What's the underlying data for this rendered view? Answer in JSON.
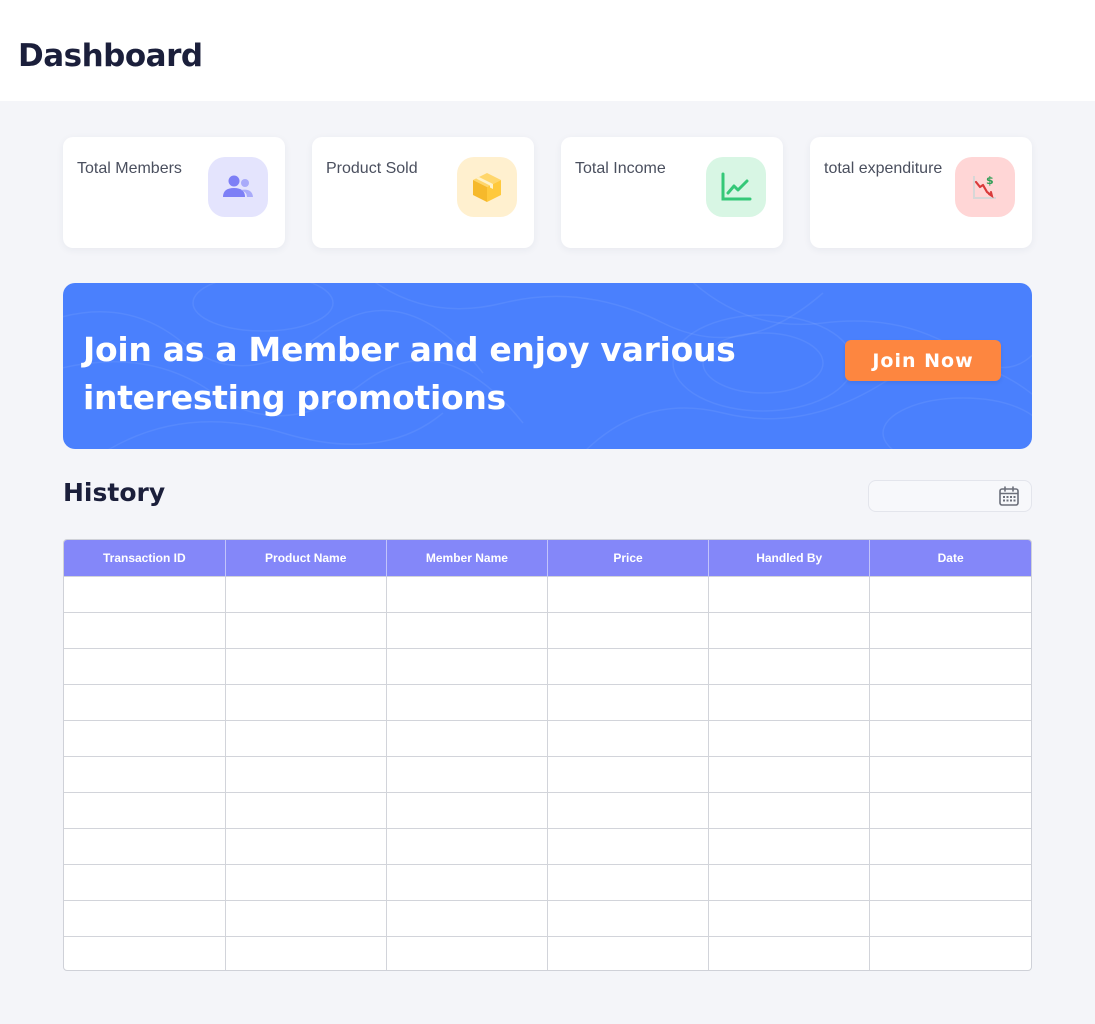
{
  "header": {
    "title": "Dashboard"
  },
  "stats": [
    {
      "label": "Total Members",
      "icon": "members-icon",
      "color": "#e4e4fd"
    },
    {
      "label": "Product Sold",
      "icon": "box-icon",
      "color": "#fff0cf"
    },
    {
      "label": "Total Income",
      "icon": "income-chart-icon",
      "color": "#d8f6e4"
    },
    {
      "label": "total expenditure",
      "icon": "expenditure-icon",
      "color": "#ffd6d6"
    }
  ],
  "banner": {
    "title": "Join as a Member and enjoy various interesting promotions",
    "button_label": "Join Now",
    "color": "#4a80fd",
    "button_color": "#fd8640"
  },
  "history": {
    "title": "History",
    "date_picker": {
      "value": "",
      "icon": "calendar-icon"
    },
    "columns": [
      "Transaction ID",
      "Product Name",
      "Member Name",
      "Price",
      "Handled By",
      "Date"
    ],
    "rows": [
      [
        "",
        "",
        "",
        "",
        "",
        ""
      ],
      [
        "",
        "",
        "",
        "",
        "",
        ""
      ],
      [
        "",
        "",
        "",
        "",
        "",
        ""
      ],
      [
        "",
        "",
        "",
        "",
        "",
        ""
      ],
      [
        "",
        "",
        "",
        "",
        "",
        ""
      ],
      [
        "",
        "",
        "",
        "",
        "",
        ""
      ],
      [
        "",
        "",
        "",
        "",
        "",
        ""
      ],
      [
        "",
        "",
        "",
        "",
        "",
        ""
      ],
      [
        "",
        "",
        "",
        "",
        "",
        ""
      ],
      [
        "",
        "",
        "",
        "",
        "",
        ""
      ],
      [
        "",
        "",
        "",
        "",
        "",
        ""
      ]
    ],
    "header_color": "#8487f9"
  }
}
